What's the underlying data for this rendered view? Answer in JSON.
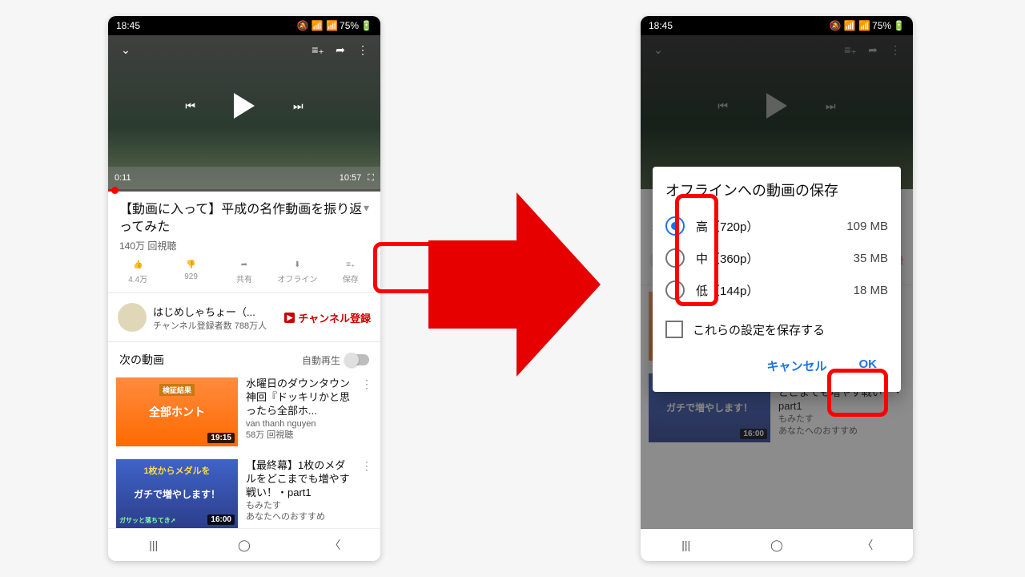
{
  "statusbar": {
    "time": "18:45",
    "battery": "75%"
  },
  "player": {
    "elapsed": "0:11",
    "duration": "10:57"
  },
  "video": {
    "title": "【動画に入って】平成の名作動画を振り返ってみた",
    "views": "140万 回視聴"
  },
  "actions": {
    "like": "4.4万",
    "dislike": "929",
    "share": "共有",
    "offline": "オフライン",
    "save": "保存"
  },
  "channel": {
    "name": "はじめしゃちょー（...",
    "subs": "チャンネル登録者数 788万人",
    "subscribe": "チャンネル登録"
  },
  "next_section": {
    "label": "次の動画",
    "autoplay": "自動再生"
  },
  "recs": [
    {
      "thumb_big": "検証結果",
      "thumb_text": "全部ホント",
      "duration": "19:15",
      "title": "水曜日のダウンタウン神回『ドッキリかと思ったら全部ホ...",
      "by": "van thanh nguyen",
      "views": "58万 回視聴"
    },
    {
      "thumb_big": "1枚からメダルを",
      "thumb_text": "ガチで増やします！",
      "duration": "16:00",
      "title": "【最終幕】1枚のメダルをどこまでも増やす戦い！・part1",
      "by": "もみたす",
      "views": "あなたへのおすすめ"
    }
  ],
  "dialog": {
    "title": "オフラインへの動画の保存",
    "options": [
      {
        "label": "高（720p）",
        "size": "109 MB"
      },
      {
        "label": "中（360p）",
        "size": "35 MB"
      },
      {
        "label": "低（144p）",
        "size": "18 MB"
      }
    ],
    "remember": "これらの設定を保存する",
    "cancel": "キャンセル",
    "ok": "OK"
  }
}
